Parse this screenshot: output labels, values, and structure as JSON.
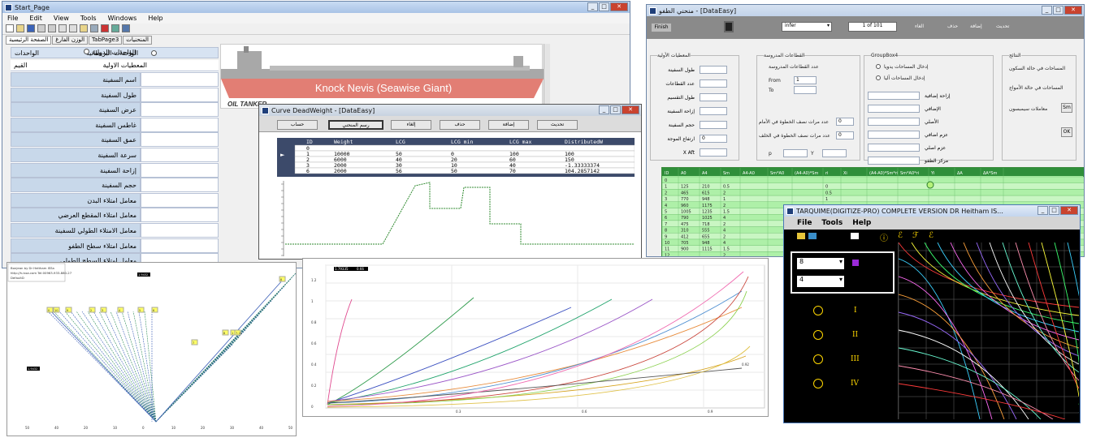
{
  "start_page": {
    "title": "Start_Page",
    "menu": [
      "File",
      "Edit",
      "View",
      "Tools",
      "Windows",
      "Help"
    ],
    "tabs": [
      "الصفحة الرئيسية",
      "الوزن الفارغ",
      "TabPage3",
      "المنحنيات"
    ],
    "units_label": "الواحدات",
    "radio_intl": "الواحدات الدولية",
    "radio_brit": "الواحدات البريطانية",
    "col_values": "القيم",
    "col_params": "المعطيات الاولية",
    "rows": [
      "اسم السفينة",
      "طول السفينة",
      "عرض السفينة",
      "غاطس السفينة",
      "عمق السفينة",
      "سرعة السفينة",
      "إزاحة السفينة",
      "حجم السفينة",
      "معامل امتلاء البدن",
      "معامل امتلاء المقطع العرضي",
      "معامل الامتلاء الطولي للسفينة",
      "معامل امتلاء سطح الطفو",
      "معامل امتلاء السطح الطولي"
    ],
    "banner_title": "Knock Nevis (Seawise Giant)",
    "banner_sub": "OIL TANKER"
  },
  "deadweight": {
    "title": "Curve DeadWeight - [DataEasy]",
    "buttons": [
      "تحديث",
      "إضافة",
      "حذف",
      "إلغاء",
      "رسم المنحني",
      "حساب"
    ],
    "headers": [
      "ID",
      "Weight",
      "LCG",
      "LCG min",
      "LCG max",
      "DistributedW"
    ],
    "rows": [
      [
        "0",
        "",
        "",
        "",
        "",
        ""
      ],
      [
        "1",
        "10000",
        "50",
        "0",
        "100",
        "100"
      ],
      [
        "2",
        "6000",
        "40",
        "20",
        "60",
        "150"
      ],
      [
        "3",
        "2000",
        "30",
        "10",
        "40",
        "-1.33333374"
      ],
      [
        "6",
        "2000",
        "56",
        "50",
        "70",
        "104.2857142"
      ]
    ]
  },
  "data_window": {
    "title": "منحني الطفو - [DataEasy]",
    "finish": "Finish",
    "combo": "infer",
    "pager": "1 of 101",
    "actions": [
      "تحديث",
      "إضافة",
      "حذف",
      "الغاء"
    ],
    "g1_title": "المعطيات الأولية",
    "g1_rows": [
      "طول السفينة",
      "عدد القطاعات",
      "طول التقسيم",
      "إزاحة السفينة",
      "حجم السفينة",
      "ارتفاع الموجة",
      "X Aft"
    ],
    "g1_val": "0",
    "g2_title": "القطاعات المدروسة",
    "g2_label": "عدد القطاعات المدروسة",
    "from_label": "From",
    "from_val": "1",
    "to_label": "To",
    "fwd_label": "عدد مرات نصف الخطوة في الأمام",
    "fwd_val": "0",
    "aft_label": "عدد مرات نصف الخطوة في الخلف",
    "aft_val": "0",
    "p_label": "p",
    "y_label": "Y",
    "g3_title": "GroupBox4",
    "g3_radios": [
      "إدخال المساحات يدويا",
      "إدخال المساحات آليا"
    ],
    "g3_rows": [
      "إزاحة إضافية",
      "الإضافي",
      "الأصلي",
      "عزم اضافي",
      "عزم اصلي",
      "مركز الطفو"
    ],
    "g4_title": "النتائج",
    "g4_rows": [
      "المساحات في حالة السكون",
      "المساحات في حالة الأمواج",
      "معاملات سيمبسون"
    ],
    "sm_btn": "Sm",
    "ok_btn": "OK",
    "grid_headers": [
      "ID",
      "A0",
      "A4",
      "Sm",
      "A4-A0",
      "Sm*A0",
      "(A4-A0)*Sm",
      "ri",
      "Xi",
      "(A4-A0)*Sm*ri",
      "Sm*A0*ri",
      "Yi",
      "ΔA",
      "ΔA*Sm"
    ],
    "grid_rows": [
      [
        "0",
        "",
        "",
        "",
        "",
        "",
        "",
        "",
        "",
        "",
        "",
        "",
        "",
        ""
      ],
      [
        "1",
        "125",
        "210",
        "0.5",
        "",
        "",
        "",
        "0",
        "",
        "",
        "",
        "",
        "",
        ""
      ],
      [
        "2",
        "465",
        "615",
        "2",
        "",
        "",
        "",
        "0.5",
        "",
        "",
        "",
        "",
        "",
        ""
      ],
      [
        "3",
        "770",
        "948",
        "1",
        "",
        "",
        "",
        "1",
        "",
        "",
        "",
        "",
        "",
        ""
      ],
      [
        "4",
        "960",
        "1175",
        "2",
        "",
        "",
        "",
        "",
        "",
        "",
        "",
        "",
        "",
        ""
      ],
      [
        "5",
        "1005",
        "1235",
        "1.5",
        "",
        "",
        "",
        "",
        "",
        "",
        "",
        "",
        "",
        ""
      ],
      [
        "6",
        "790",
        "1025",
        "4",
        "",
        "",
        "",
        "",
        "",
        "",
        "",
        "",
        "",
        ""
      ],
      [
        "7",
        "475",
        "718",
        "2",
        "",
        "",
        "",
        "",
        "",
        "",
        "",
        "",
        "",
        ""
      ],
      [
        "8",
        "310",
        "555",
        "4",
        "",
        "",
        "",
        "",
        "",
        "",
        "",
        "",
        "",
        ""
      ],
      [
        "9",
        "412",
        "655",
        "2",
        "",
        "",
        "",
        "",
        "",
        "",
        "",
        "",
        "",
        ""
      ],
      [
        "10",
        "705",
        "948",
        "4",
        "",
        "",
        "",
        "",
        "",
        "",
        "",
        "",
        "",
        ""
      ],
      [
        "11",
        "900",
        "1115",
        "1.5",
        "",
        "",
        "",
        "",
        "",
        "",
        "",
        "",
        "",
        ""
      ],
      [
        "12",
        "",
        "",
        "2",
        "",
        "",
        "",
        "",
        "",
        "",
        "",
        "",
        "",
        ""
      ]
    ]
  },
  "tarquime": {
    "title": "TARQUIME(DIGITIZE-PRO) COMPLETE VERSION DR Heitham IS...",
    "menu": [
      "File",
      "Tools",
      "Help"
    ],
    "combo1": "8",
    "combo2": "4",
    "roman": [
      "I",
      "II",
      "III",
      "IV"
    ]
  },
  "bonjean": {
    "caption": [
      "Bonjean by Dr Heitham ISSa",
      "http://h-issa.com Tel:00963-933-880-27",
      "DefaultD"
    ],
    "labels": [
      "1.9432",
      "1.9432"
    ],
    "stations": [
      "0",
      "10",
      "9",
      "2",
      "3",
      "4",
      "5",
      "6",
      "7",
      "8",
      "1",
      "7.15",
      "8"
    ],
    "axis_ticks": [
      "50",
      "40",
      "20",
      "10",
      "0",
      "10",
      "20",
      "30",
      "40",
      "50"
    ]
  },
  "hydro_chart": {
    "top_tags": [
      "1.79335",
      "0.66"
    ],
    "y_ticks": [
      "1.2",
      "1",
      "0.8",
      "0.6",
      "0.4",
      "0.2",
      "0"
    ],
    "x_ticks": [
      "0.3",
      "0.6",
      "0.9"
    ],
    "point_label": "0.92"
  },
  "colors": {
    "grid_green": "#aef0a8",
    "titlebar": "#bcd2ee",
    "banner_red": "#e27e74",
    "ship_gray": "#a8a8a8"
  }
}
